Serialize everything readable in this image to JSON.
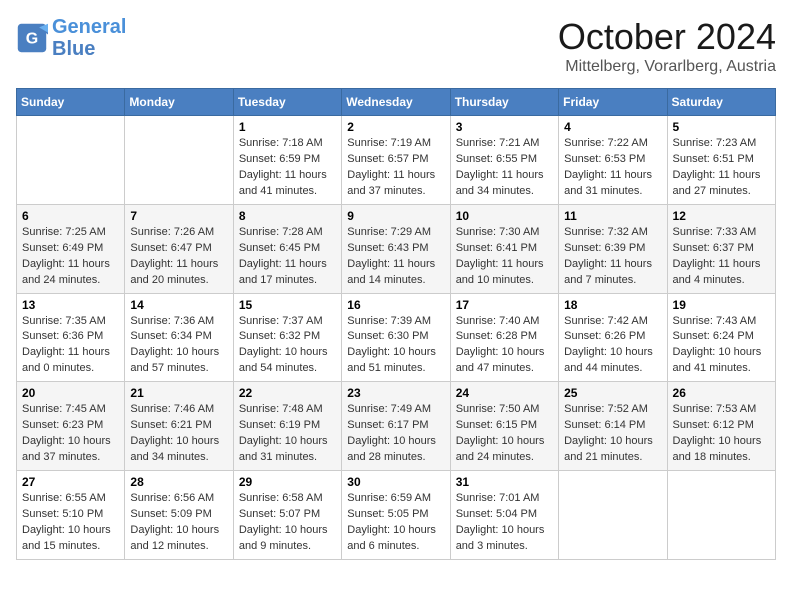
{
  "header": {
    "logo_general": "General",
    "logo_blue": "Blue",
    "month": "October 2024",
    "location": "Mittelberg, Vorarlberg, Austria"
  },
  "days_of_week": [
    "Sunday",
    "Monday",
    "Tuesday",
    "Wednesday",
    "Thursday",
    "Friday",
    "Saturday"
  ],
  "weeks": [
    [
      {
        "day": "",
        "info": ""
      },
      {
        "day": "",
        "info": ""
      },
      {
        "day": "1",
        "info": "Sunrise: 7:18 AM\nSunset: 6:59 PM\nDaylight: 11 hours and 41 minutes."
      },
      {
        "day": "2",
        "info": "Sunrise: 7:19 AM\nSunset: 6:57 PM\nDaylight: 11 hours and 37 minutes."
      },
      {
        "day": "3",
        "info": "Sunrise: 7:21 AM\nSunset: 6:55 PM\nDaylight: 11 hours and 34 minutes."
      },
      {
        "day": "4",
        "info": "Sunrise: 7:22 AM\nSunset: 6:53 PM\nDaylight: 11 hours and 31 minutes."
      },
      {
        "day": "5",
        "info": "Sunrise: 7:23 AM\nSunset: 6:51 PM\nDaylight: 11 hours and 27 minutes."
      }
    ],
    [
      {
        "day": "6",
        "info": "Sunrise: 7:25 AM\nSunset: 6:49 PM\nDaylight: 11 hours and 24 minutes."
      },
      {
        "day": "7",
        "info": "Sunrise: 7:26 AM\nSunset: 6:47 PM\nDaylight: 11 hours and 20 minutes."
      },
      {
        "day": "8",
        "info": "Sunrise: 7:28 AM\nSunset: 6:45 PM\nDaylight: 11 hours and 17 minutes."
      },
      {
        "day": "9",
        "info": "Sunrise: 7:29 AM\nSunset: 6:43 PM\nDaylight: 11 hours and 14 minutes."
      },
      {
        "day": "10",
        "info": "Sunrise: 7:30 AM\nSunset: 6:41 PM\nDaylight: 11 hours and 10 minutes."
      },
      {
        "day": "11",
        "info": "Sunrise: 7:32 AM\nSunset: 6:39 PM\nDaylight: 11 hours and 7 minutes."
      },
      {
        "day": "12",
        "info": "Sunrise: 7:33 AM\nSunset: 6:37 PM\nDaylight: 11 hours and 4 minutes."
      }
    ],
    [
      {
        "day": "13",
        "info": "Sunrise: 7:35 AM\nSunset: 6:36 PM\nDaylight: 11 hours and 0 minutes."
      },
      {
        "day": "14",
        "info": "Sunrise: 7:36 AM\nSunset: 6:34 PM\nDaylight: 10 hours and 57 minutes."
      },
      {
        "day": "15",
        "info": "Sunrise: 7:37 AM\nSunset: 6:32 PM\nDaylight: 10 hours and 54 minutes."
      },
      {
        "day": "16",
        "info": "Sunrise: 7:39 AM\nSunset: 6:30 PM\nDaylight: 10 hours and 51 minutes."
      },
      {
        "day": "17",
        "info": "Sunrise: 7:40 AM\nSunset: 6:28 PM\nDaylight: 10 hours and 47 minutes."
      },
      {
        "day": "18",
        "info": "Sunrise: 7:42 AM\nSunset: 6:26 PM\nDaylight: 10 hours and 44 minutes."
      },
      {
        "day": "19",
        "info": "Sunrise: 7:43 AM\nSunset: 6:24 PM\nDaylight: 10 hours and 41 minutes."
      }
    ],
    [
      {
        "day": "20",
        "info": "Sunrise: 7:45 AM\nSunset: 6:23 PM\nDaylight: 10 hours and 37 minutes."
      },
      {
        "day": "21",
        "info": "Sunrise: 7:46 AM\nSunset: 6:21 PM\nDaylight: 10 hours and 34 minutes."
      },
      {
        "day": "22",
        "info": "Sunrise: 7:48 AM\nSunset: 6:19 PM\nDaylight: 10 hours and 31 minutes."
      },
      {
        "day": "23",
        "info": "Sunrise: 7:49 AM\nSunset: 6:17 PM\nDaylight: 10 hours and 28 minutes."
      },
      {
        "day": "24",
        "info": "Sunrise: 7:50 AM\nSunset: 6:15 PM\nDaylight: 10 hours and 24 minutes."
      },
      {
        "day": "25",
        "info": "Sunrise: 7:52 AM\nSunset: 6:14 PM\nDaylight: 10 hours and 21 minutes."
      },
      {
        "day": "26",
        "info": "Sunrise: 7:53 AM\nSunset: 6:12 PM\nDaylight: 10 hours and 18 minutes."
      }
    ],
    [
      {
        "day": "27",
        "info": "Sunrise: 6:55 AM\nSunset: 5:10 PM\nDaylight: 10 hours and 15 minutes."
      },
      {
        "day": "28",
        "info": "Sunrise: 6:56 AM\nSunset: 5:09 PM\nDaylight: 10 hours and 12 minutes."
      },
      {
        "day": "29",
        "info": "Sunrise: 6:58 AM\nSunset: 5:07 PM\nDaylight: 10 hours and 9 minutes."
      },
      {
        "day": "30",
        "info": "Sunrise: 6:59 AM\nSunset: 5:05 PM\nDaylight: 10 hours and 6 minutes."
      },
      {
        "day": "31",
        "info": "Sunrise: 7:01 AM\nSunset: 5:04 PM\nDaylight: 10 hours and 3 minutes."
      },
      {
        "day": "",
        "info": ""
      },
      {
        "day": "",
        "info": ""
      }
    ]
  ]
}
